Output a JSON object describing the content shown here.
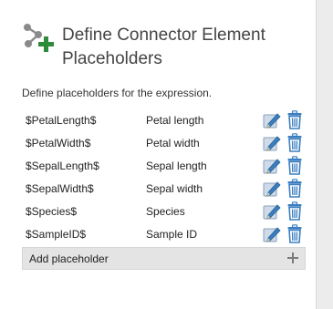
{
  "header": {
    "title": "Define Connector Element Placeholders",
    "icon": "connector-add-icon"
  },
  "description": "Define placeholders for the expression.",
  "placeholders": [
    {
      "name": "$PetalLength$",
      "label": "Petal length"
    },
    {
      "name": "$PetalWidth$",
      "label": "Petal width"
    },
    {
      "name": "$SepalLength$",
      "label": "Sepal length"
    },
    {
      "name": "$SepalWidth$",
      "label": "Sepal width"
    },
    {
      "name": "$Species$",
      "label": "Species"
    },
    {
      "name": "$SampleID$",
      "label": "Sample ID"
    }
  ],
  "row_icons": {
    "edit": "edit-pencil-icon",
    "delete": "trash-icon"
  },
  "add_placeholder": {
    "label": "Add placeholder",
    "icon": "plus-icon"
  },
  "colors": {
    "accent_green": "#2e8b3a",
    "icon_blue": "#3a7ec0",
    "icon_gray": "#7a7a7a"
  }
}
